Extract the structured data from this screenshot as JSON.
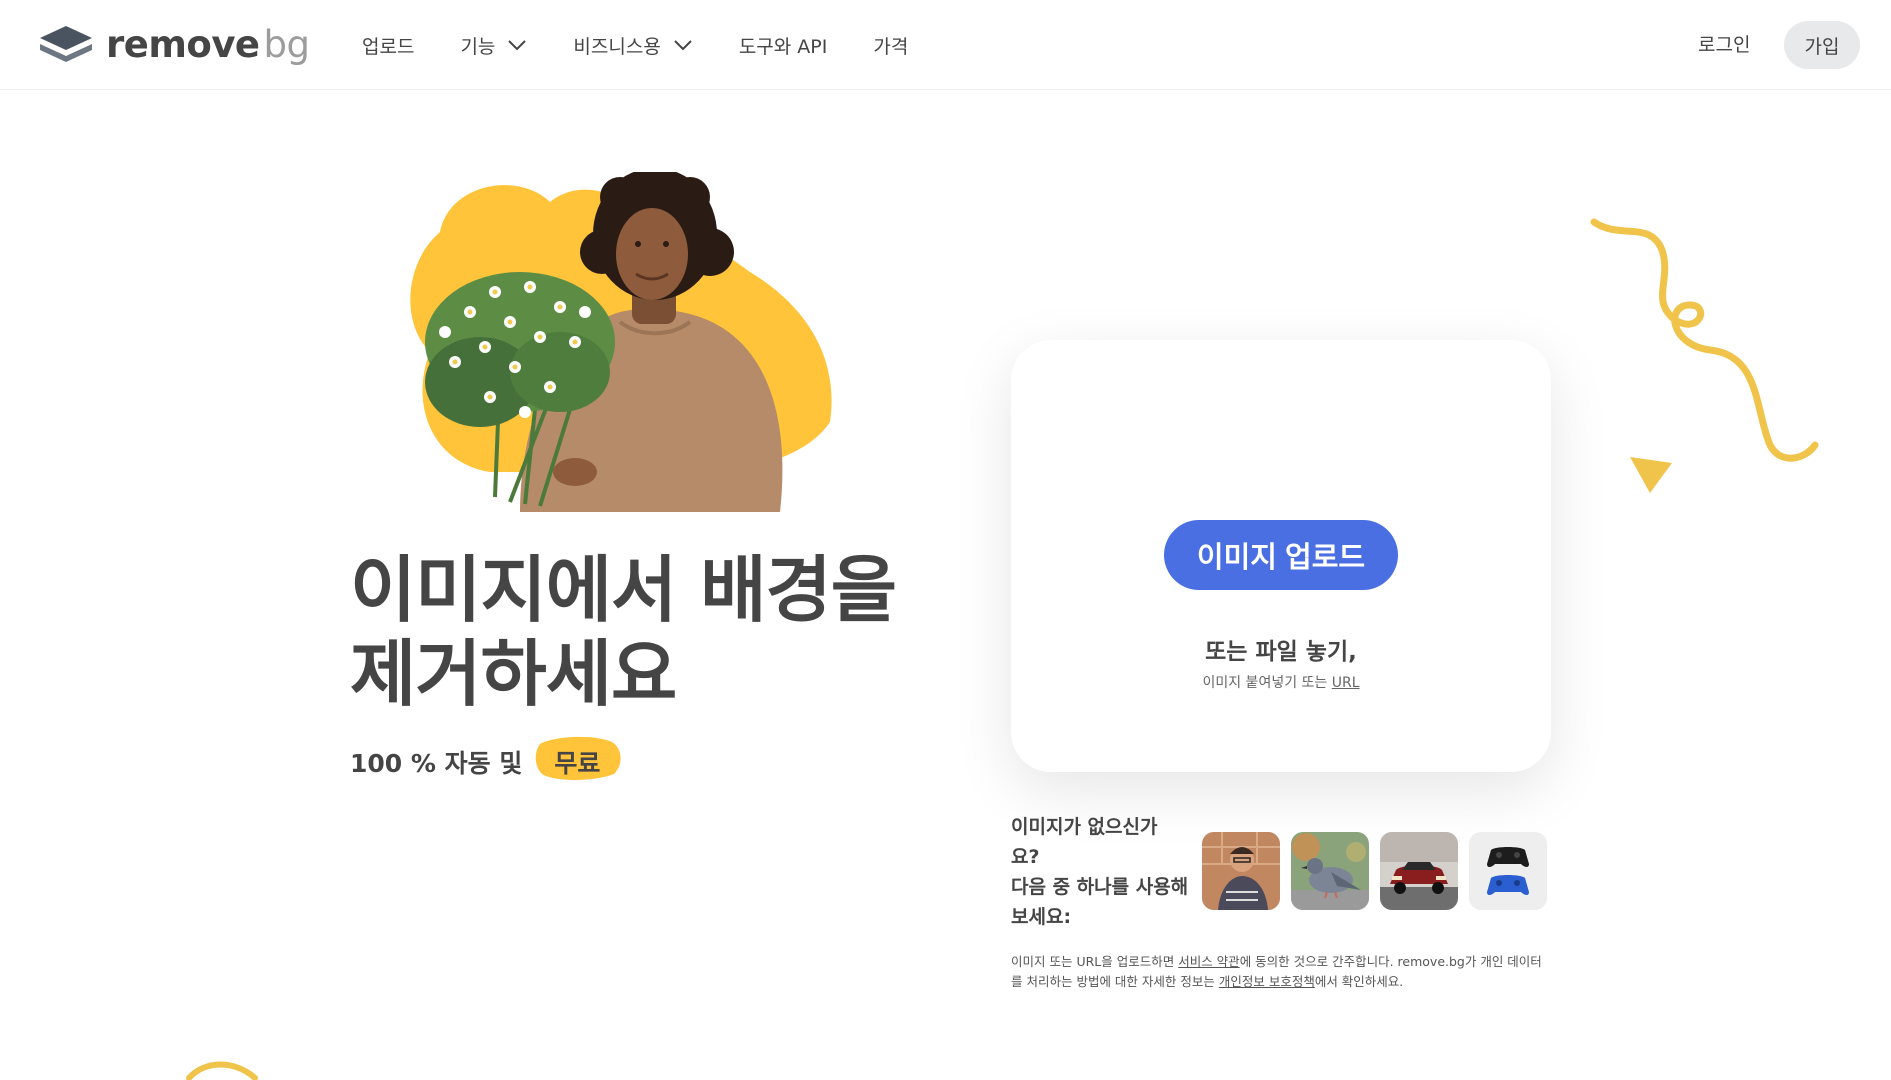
{
  "header": {
    "logo_main": "remove",
    "logo_suffix": "bg",
    "nav": [
      {
        "label": "업로드",
        "has_dropdown": false
      },
      {
        "label": "기능",
        "has_dropdown": true
      },
      {
        "label": "비즈니스용",
        "has_dropdown": true
      },
      {
        "label": "도구와 API",
        "has_dropdown": false
      },
      {
        "label": "가격",
        "has_dropdown": false
      }
    ],
    "login": "로그인",
    "signup": "가입"
  },
  "hero": {
    "headline_line1": "이미지에서 배경을",
    "headline_line2": "제거하세요",
    "subtitle": "100 % 자동 및",
    "free_badge": "무료"
  },
  "upload": {
    "button_label": "이미지 업로드",
    "drop_text": "또는 파일 놓기,",
    "paste_text": "이미지 붙여넣기 또는",
    "url_link": "URL"
  },
  "samples": {
    "line1": "이미지가 없으신가",
    "line2": "요?",
    "line3": "다음 중 하나를 사용해",
    "line4": "보세요:",
    "thumbnails": [
      "person-photo",
      "pigeon-photo",
      "car-photo",
      "gamepads-photo"
    ]
  },
  "legal": {
    "part1": "이미지 또는 URL을 업로드하면 ",
    "tos_link": "서비스 약관",
    "part2": "에 동의한 것으로 간주합니다. remove.bg가 개인 데이터를 처리하는 방법에 대한 자세한 정보는 ",
    "privacy_link": "개인정보 보호정책",
    "part3": "에서 확인하세요."
  },
  "colors": {
    "accent_blue": "#4a6fe3",
    "brand_yellow": "#ffc43a",
    "text_dark": "#454545",
    "button_gray": "#e7e9eb"
  }
}
